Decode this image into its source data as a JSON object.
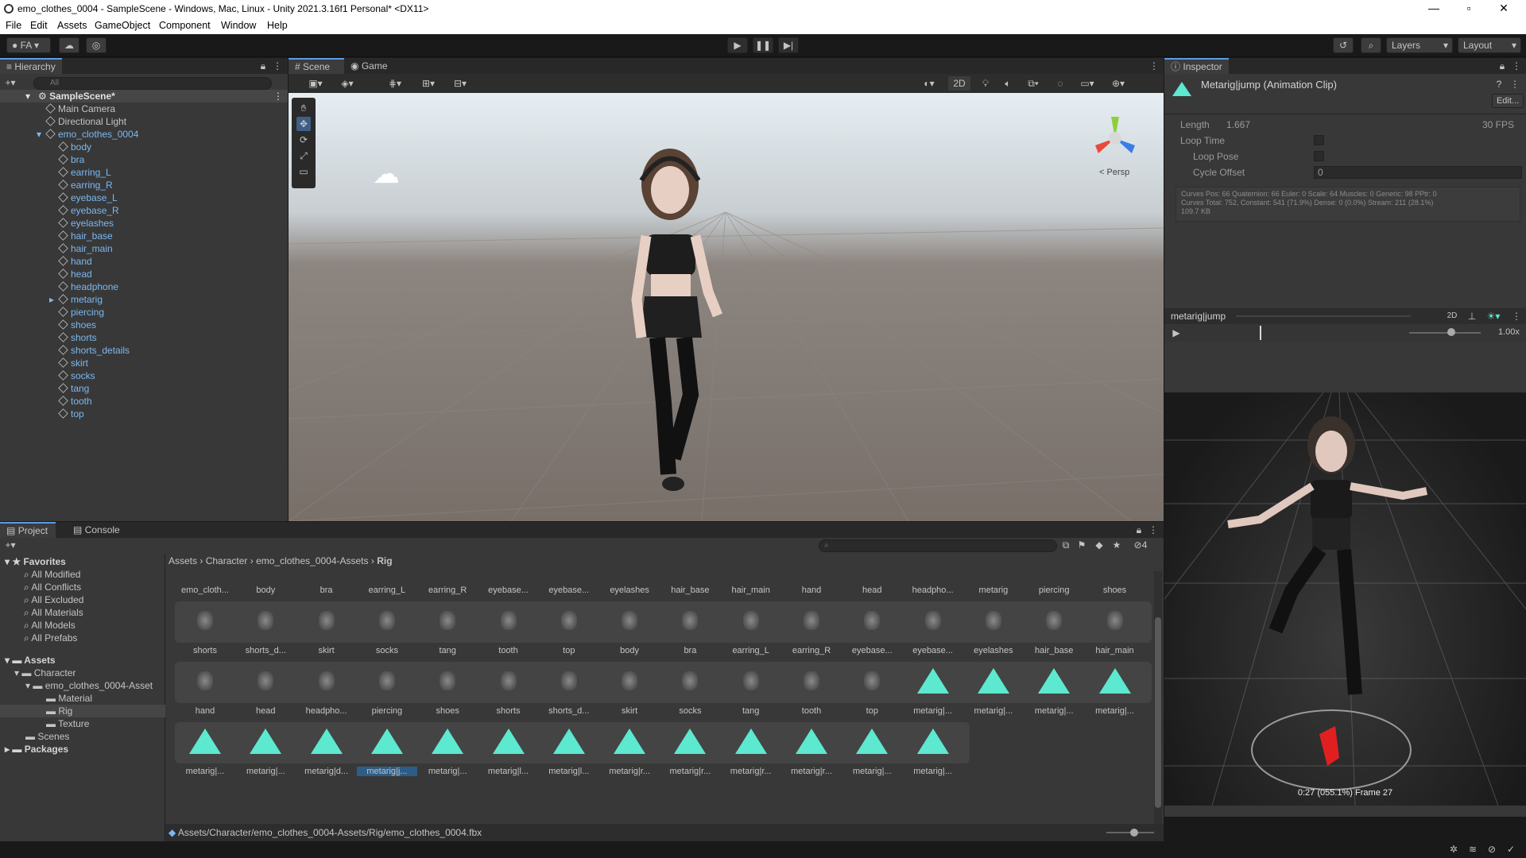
{
  "window": {
    "title": "emo_clothes_0004 - SampleScene - Windows, Mac, Linux - Unity 2021.3.16f1 Personal* <DX11>"
  },
  "menu": [
    "File",
    "Edit",
    "Assets",
    "GameObject",
    "Component",
    "Window",
    "Help"
  ],
  "toolbar": {
    "account": "FA",
    "layers": "Layers",
    "layout": "Layout"
  },
  "hierarchy": {
    "tab": "Hierarchy",
    "search_placeholder": "All",
    "scene": "SampleScene*",
    "items": [
      "Main Camera",
      "Directional Light",
      "emo_clothes_0004",
      "body",
      "bra",
      "earring_L",
      "earring_R",
      "eyebase_L",
      "eyebase_R",
      "eyelashes",
      "hair_base",
      "hair_main",
      "hand",
      "head",
      "headphone",
      "metarig",
      "piercing",
      "shoes",
      "shorts",
      "shorts_details",
      "skirt",
      "socks",
      "tang",
      "tooth",
      "top"
    ]
  },
  "scene": {
    "tabs": [
      "Scene",
      "Game"
    ],
    "mode2d": "2D",
    "persp": "Persp"
  },
  "inspector": {
    "tab": "Inspector",
    "title": "Metarig|jump (Animation Clip)",
    "edit": "Edit...",
    "length_label": "Length",
    "length": "1.667",
    "fps": "30 FPS",
    "loop_time": "Loop Time",
    "loop_pose": "Loop Pose",
    "cycle_offset": "Cycle Offset",
    "cycle_offset_val": "0",
    "curves1": "Curves Pos: 66 Quaternion: 66 Euler: 0 Scale: 64 Muscles: 0 Generic: 98 PPtr: 0",
    "curves2": "Curves Total: 752, Constant: 541 (71.9%) Dense: 0 (0.0%) Stream: 211 (28.1%)",
    "size": "109.7 KB",
    "preview_name": "metarig|jump",
    "preview_2d": "2D",
    "speed": "1.00x",
    "progress": 0.36,
    "time": "0:27 (055.1%) Frame 27"
  },
  "project": {
    "tabs": [
      "Project",
      "Console"
    ],
    "favorites_label": "Favorites",
    "favorites": [
      "All Modified",
      "All Conflicts",
      "All Excluded",
      "All Materials",
      "All Models",
      "All Prefabs"
    ],
    "assets_label": "Assets",
    "tree": [
      "Character",
      "emo_clothes_0004-Asset",
      "Material",
      "Rig",
      "Texture",
      "Scenes"
    ],
    "packages_label": "Packages",
    "breadcrumb": [
      "Assets",
      "Character",
      "emo_clothes_0004-Assets",
      "Rig"
    ],
    "row0": [
      "emo_cloth...",
      "body",
      "bra",
      "earring_L",
      "earring_R",
      "eyebase...",
      "eyebase...",
      "eyelashes",
      "hair_base",
      "hair_main",
      "hand",
      "head",
      "headpho...",
      "metarig",
      "piercing",
      "shoes"
    ],
    "row1": [
      "shorts",
      "shorts_d...",
      "skirt",
      "socks",
      "tang",
      "tooth",
      "top",
      "body",
      "bra",
      "earring_L",
      "earring_R",
      "eyebase...",
      "eyebase...",
      "eyelashes",
      "hair_base",
      "hair_main"
    ],
    "row2": [
      "hand",
      "head",
      "headpho...",
      "piercing",
      "shoes",
      "shorts",
      "shorts_d...",
      "skirt",
      "socks",
      "tang",
      "tooth",
      "top",
      "metarig|...",
      "metarig|...",
      "metarig|...",
      "metarig|..."
    ],
    "row3": [
      "metarig|...",
      "metarig|...",
      "metarig|d...",
      "metarig|j...",
      "metarig|...",
      "metarig|l...",
      "metarig|l...",
      "metarig|r...",
      "metarig|r...",
      "metarig|r...",
      "metarig|r...",
      "metarig|...",
      "metarig|..."
    ],
    "hidden_count": "4",
    "path": "Assets/Character/emo_clothes_0004-Assets/Rig/emo_clothes_0004.fbx"
  },
  "colors": {
    "accent": "#5de8d0",
    "link": "#7cb8f0",
    "selection": "#2c5d87"
  }
}
